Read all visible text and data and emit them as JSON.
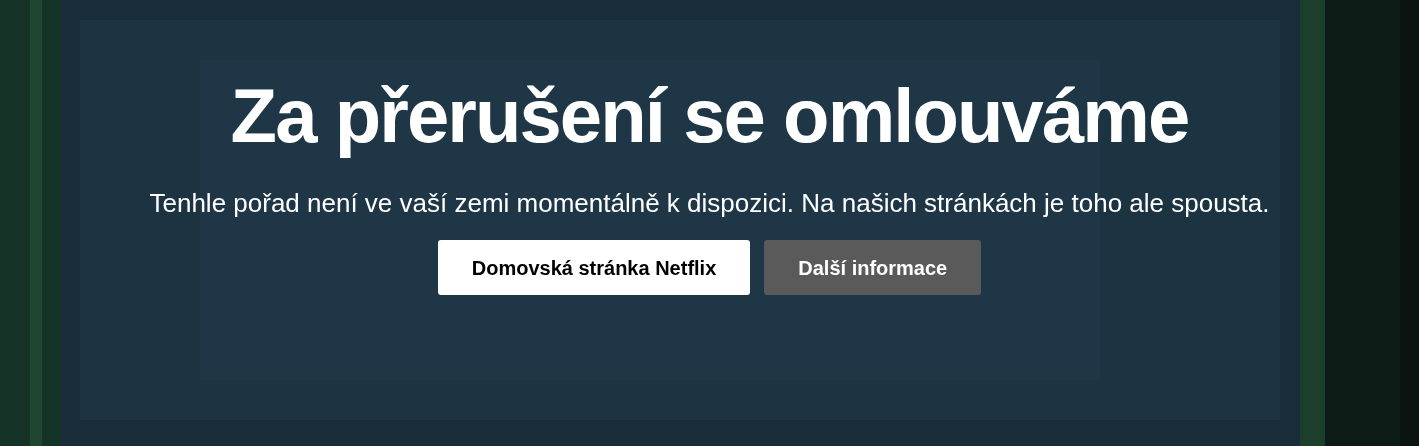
{
  "title": "Za přerušení se omlouváme",
  "message": "Tenhle pořad není ve vaší zemi momentálně k dispozici. Na našich stránkách je toho ale spousta.",
  "buttons": [
    {
      "label": "Domovská stránka Netflix",
      "kind": "primary"
    },
    {
      "label": "Další informace",
      "kind": "secondary"
    }
  ]
}
